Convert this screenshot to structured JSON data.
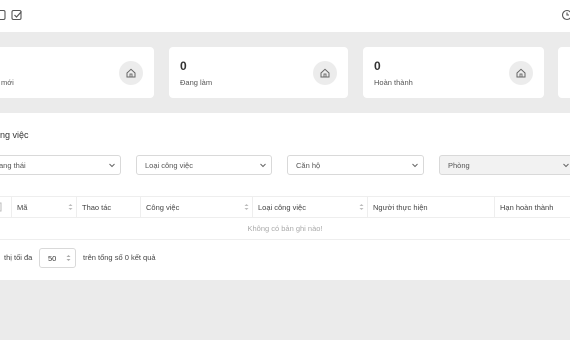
{
  "toolbar": {
    "icons": [
      "panel-icon",
      "checklist-icon",
      "history-icon"
    ]
  },
  "summary_cards": [
    {
      "count": "",
      "label": "mới",
      "icon": "home-icon"
    },
    {
      "count": "0",
      "label": "Đang làm",
      "icon": "home-icon"
    },
    {
      "count": "0",
      "label": "Hoàn thành",
      "icon": "home-icon"
    }
  ],
  "section": {
    "title": "ng việc",
    "filters": {
      "status": "ang thái",
      "type": "Loại công việc",
      "apartment": "Căn hộ",
      "room": "Phòng"
    }
  },
  "table": {
    "columns": [
      "Mã",
      "Thao tác",
      "Công việc",
      "Loại công việc",
      "Người thực hiện",
      "Hạn hoàn thành"
    ],
    "empty_text": "Không có bản ghi nào!"
  },
  "pagination": {
    "prefix": "thị tối đa",
    "page_size": "50",
    "suffix": "trên tổng số 0 kết quả"
  },
  "colors": {
    "background": "#ebebeb",
    "surface": "#ffffff",
    "border": "#d9d9d9"
  }
}
